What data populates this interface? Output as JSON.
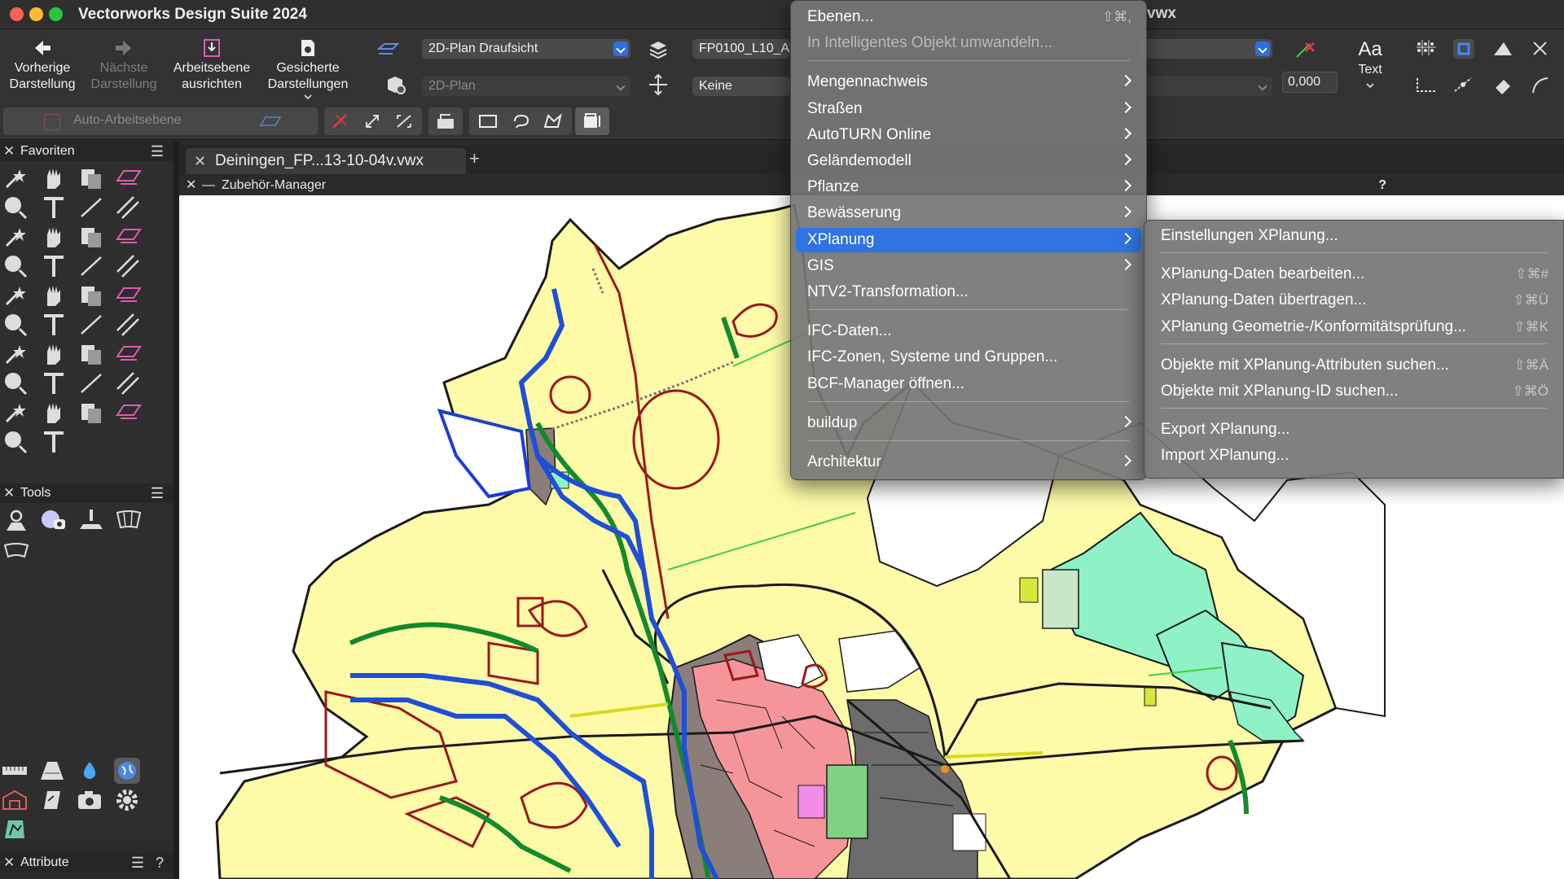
{
  "window": {
    "title": "Vectorworks Design Suite 2024",
    "file_suffix": "vwx"
  },
  "toolbar": {
    "prev_view": "Vorherige\nDarstellung",
    "next_view": "Nächste\nDarstellung",
    "align_plane": "Arbeitsebene\nausrichten",
    "saved_views": "Gesicherte\nDarstellungen",
    "view_mode": "2D-Plan Draufsicht",
    "plane_mode": "2D-Plan",
    "layer_name": "FP0100_L10_A",
    "class_name": "Keine",
    "number_value": "0,000",
    "text_tool": "Text",
    "text_tool_glyph": "Aa",
    "auto_plane": "Auto-Arbeitsebene"
  },
  "palettes": {
    "favorites": "Favoriten",
    "tools": "Tools",
    "attributes": "Attribute",
    "attributes_help": "?"
  },
  "document": {
    "tab_label": "Deiningen_FP...13-10-04v.vwx",
    "accessory_manager": "Zubehör-Manager",
    "accessory_help": "?"
  },
  "menu": {
    "items": [
      {
        "label": "Ebenen...",
        "shortcut": "⇧⌘,",
        "enabled": true,
        "submenu": false
      },
      {
        "label": "In Intelligentes Objekt umwandeln...",
        "shortcut": "",
        "enabled": false,
        "submenu": false
      },
      {
        "label": "Mengennachweis",
        "shortcut": "",
        "enabled": true,
        "submenu": true
      },
      {
        "label": "Straßen",
        "shortcut": "",
        "enabled": true,
        "submenu": true
      },
      {
        "label": "AutoTURN Online",
        "shortcut": "",
        "enabled": true,
        "submenu": true
      },
      {
        "label": "Geländemodell",
        "shortcut": "",
        "enabled": true,
        "submenu": true
      },
      {
        "label": "Pflanze",
        "shortcut": "",
        "enabled": true,
        "submenu": true
      },
      {
        "label": "Bewässerung",
        "shortcut": "",
        "enabled": true,
        "submenu": true
      },
      {
        "label": "XPlanung",
        "shortcut": "",
        "enabled": true,
        "submenu": true,
        "selected": true
      },
      {
        "label": "GIS",
        "shortcut": "",
        "enabled": true,
        "submenu": true
      },
      {
        "label": "NTV2-Transformation...",
        "shortcut": "",
        "enabled": true,
        "submenu": false
      },
      {
        "label": "IFC-Daten...",
        "shortcut": "",
        "enabled": true,
        "submenu": false
      },
      {
        "label": "IFC-Zonen, Systeme und Gruppen...",
        "shortcut": "",
        "enabled": true,
        "submenu": false
      },
      {
        "label": "BCF-Manager öffnen...",
        "shortcut": "",
        "enabled": true,
        "submenu": false
      },
      {
        "label": "buildup",
        "shortcut": "",
        "enabled": true,
        "submenu": true
      },
      {
        "label": "Architektur",
        "shortcut": "",
        "enabled": true,
        "submenu": true
      }
    ]
  },
  "submenu": {
    "items": [
      {
        "label": "Einstellungen XPlanung...",
        "shortcut": ""
      },
      {
        "label": "XPlanung-Daten bearbeiten...",
        "shortcut": "⇧⌘#"
      },
      {
        "label": "XPlanung-Daten übertragen...",
        "shortcut": "⇧⌘Ü"
      },
      {
        "label": "XPlanung Geometrie-/Konformitätsprüfung...",
        "shortcut": "⇧⌘K"
      },
      {
        "label": "Objekte mit XPlanung-Attributen suchen...",
        "shortcut": "⇧⌘Ä"
      },
      {
        "label": "Objekte mit XPlanung-ID suchen...",
        "shortcut": "⇧⌘Ö"
      },
      {
        "label": "Export XPlanung...",
        "shortcut": ""
      },
      {
        "label": "Import XPlanung...",
        "shortcut": ""
      }
    ]
  },
  "colors": {
    "accent": "#3173e3",
    "map_base": "#fdfaa8",
    "map_outline": "#1a1a1a",
    "river": "#1f4fd6",
    "green_corridor": "#148a2a",
    "red_boundary": "#9b1818",
    "residential": "#f5959a",
    "built_area": "#8a7d7a",
    "industrial": "#6c6c6c",
    "meadow": "#8ef2c6"
  }
}
